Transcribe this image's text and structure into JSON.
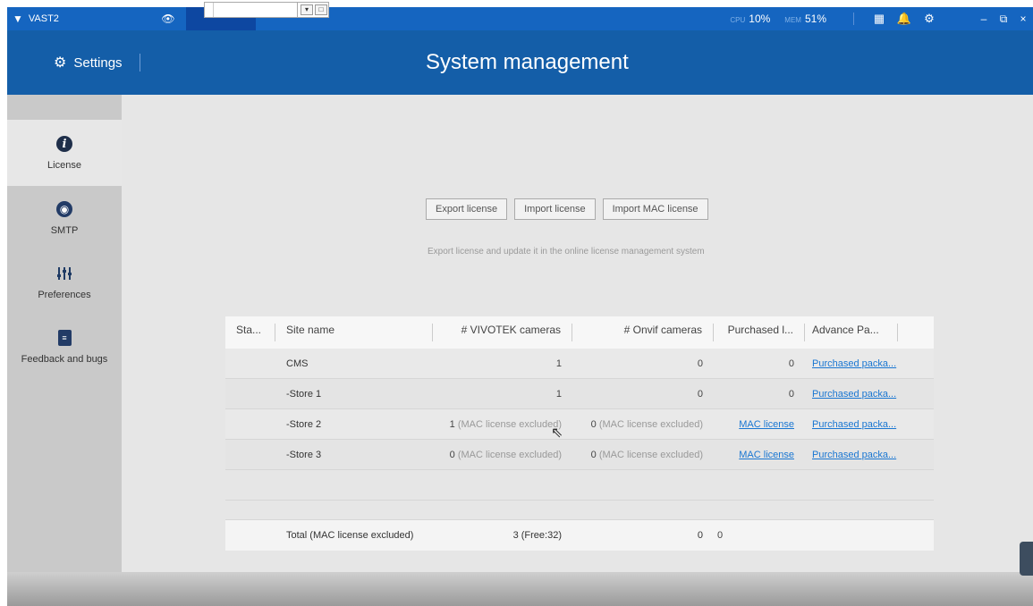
{
  "app": {
    "name": "VAST2"
  },
  "titlebar": {
    "cpu_label": "CPU",
    "cpu_value": "10%",
    "mem_label": "MEM",
    "mem_value": "51%",
    "icons": [
      "eye-icon",
      "grid-icon",
      "bell-icon",
      "gear-icon"
    ],
    "win": {
      "minimize": "–",
      "restore": "⧉",
      "close": "×"
    }
  },
  "header": {
    "settings_label": "Settings",
    "title": "System management"
  },
  "sidebar": {
    "items": [
      {
        "label": "License",
        "icon": "info-icon"
      },
      {
        "label": "SMTP",
        "icon": "globe-icon"
      },
      {
        "label": "Preferences",
        "icon": "sliders-icon"
      },
      {
        "label": "Feedback and bugs",
        "icon": "feedback-icon"
      }
    ]
  },
  "main": {
    "buttons": {
      "export": "Export license",
      "import": "Import license",
      "import_mac": "Import MAC license"
    },
    "hint": "Export license and update it in the online license management system",
    "table": {
      "headers": [
        "Sta...",
        "Site name",
        "# VIVOTEK cameras",
        "# Onvif cameras",
        "Purchased l...",
        "Advance Pa..."
      ],
      "rows": [
        {
          "site": "CMS",
          "vivotek": "1",
          "vivotek_note": "",
          "onvif": "0",
          "onvif_note": "",
          "purchased": "0",
          "advance": "Purchased packa..."
        },
        {
          "site": "-Store 1",
          "vivotek": "1",
          "vivotek_note": "",
          "onvif": "0",
          "onvif_note": "",
          "purchased": "0",
          "advance": "Purchased packa..."
        },
        {
          "site": "-Store 2",
          "vivotek": "1",
          "vivotek_note": "(MAC license excluded)",
          "onvif": "0",
          "onvif_note": "(MAC license excluded)",
          "purchased": "MAC license",
          "advance": "Purchased packa..."
        },
        {
          "site": "-Store 3",
          "vivotek": "0",
          "vivotek_note": "(MAC license excluded)",
          "onvif": "0",
          "onvif_note": "(MAC license excluded)",
          "purchased": "MAC license",
          "advance": "Purchased packa..."
        }
      ],
      "total": {
        "label": "Total (MAC license excluded)",
        "vivotek": "3 (Free:32)",
        "onvif": "0",
        "purchased": "0"
      }
    }
  }
}
